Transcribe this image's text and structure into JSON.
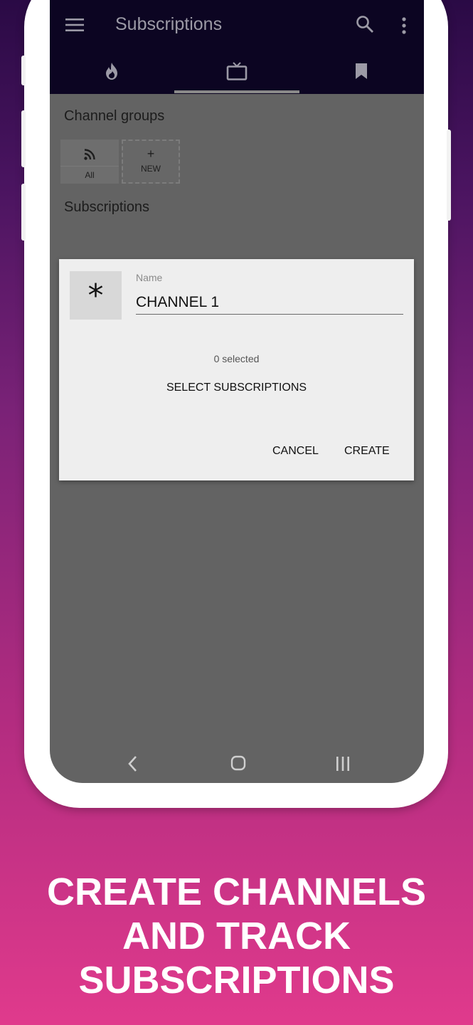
{
  "appbar": {
    "title": "Subscriptions",
    "menu_icon": "hamburger-menu-icon",
    "search_icon": "search-icon",
    "overflow_icon": "more-vert-icon"
  },
  "tabs": [
    {
      "icon": "fire-icon",
      "selected": false
    },
    {
      "icon": "tv-icon",
      "selected": true
    },
    {
      "icon": "bookmark-icon",
      "selected": false
    }
  ],
  "channel_groups": {
    "heading": "Channel groups",
    "items": [
      {
        "icon": "rss-icon",
        "label": "All"
      },
      {
        "icon": "plus-icon",
        "symbol": "+",
        "label": "NEW"
      }
    ]
  },
  "subscriptions": {
    "heading": "Subscriptions"
  },
  "dialog": {
    "icon_symbol": "*",
    "name_label": "Name",
    "name_value": "CHANNEL 1",
    "selected_count": "0 selected",
    "select_button": "SELECT SUBSCRIPTIONS",
    "cancel_button": "CANCEL",
    "create_button": "CREATE"
  },
  "navbar": {
    "back_icon": "back-chevron-icon",
    "home_icon": "home-icon",
    "recents_icon": "recents-icon"
  },
  "caption": {
    "line1": "CREATE CHANNELS",
    "line2": "AND TRACK",
    "line3": "SUBSCRIPTIONS"
  },
  "colors": {
    "appbar": "#0c0522",
    "screen_overlay": "#636363",
    "dialog_bg": "#eeeeee",
    "background_top": "#2a0a45",
    "background_bottom": "#e03a8c"
  }
}
